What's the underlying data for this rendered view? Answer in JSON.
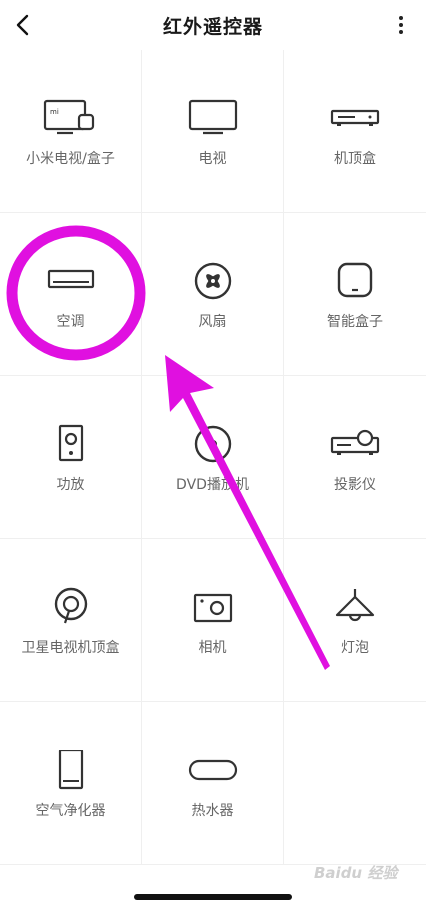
{
  "header": {
    "title": "红外遥控器",
    "back_icon": "chevron-left-icon",
    "more_icon": "more-vertical-icon"
  },
  "devices": [
    {
      "label": "小米电视/盒子",
      "icon": "mi-tv-box-icon"
    },
    {
      "label": "电视",
      "icon": "tv-icon"
    },
    {
      "label": "机顶盒",
      "icon": "set-top-box-icon"
    },
    {
      "label": "空调",
      "icon": "air-conditioner-icon"
    },
    {
      "label": "风扇",
      "icon": "fan-icon"
    },
    {
      "label": "智能盒子",
      "icon": "smart-box-icon"
    },
    {
      "label": "功放",
      "icon": "amplifier-speaker-icon"
    },
    {
      "label": "DVD播放机",
      "icon": "dvd-player-icon"
    },
    {
      "label": "投影仪",
      "icon": "projector-icon"
    },
    {
      "label": "卫星电视机顶盒",
      "icon": "satellite-icon"
    },
    {
      "label": "相机",
      "icon": "camera-icon"
    },
    {
      "label": "灯泡",
      "icon": "lamp-icon"
    },
    {
      "label": "空气净化器",
      "icon": "air-purifier-icon"
    },
    {
      "label": "热水器",
      "icon": "water-heater-icon"
    }
  ],
  "annotation": {
    "highlight_color": "#e010e0",
    "highlight_target": "空调"
  },
  "watermark": "Baidu 经验"
}
